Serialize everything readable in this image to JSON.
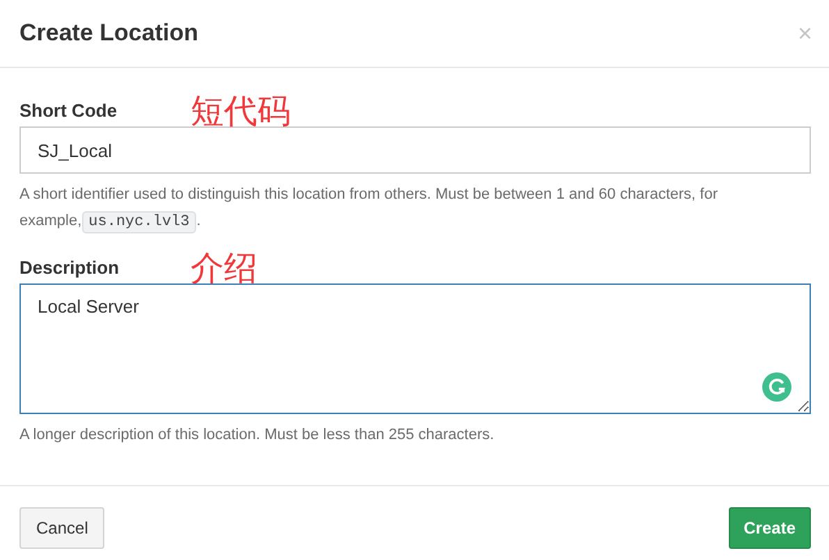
{
  "dialog": {
    "title": "Create Location",
    "close": "×"
  },
  "fields": [
    {
      "kind": "input",
      "label": "Short Code",
      "annotation": "短代码",
      "value": "SJ_Local",
      "focused": false,
      "help": "A short identifier used to distinguish this location from others. Must be between 1 and 60 characters, for example,",
      "example": "us.nyc.lvl3",
      "help_end": "."
    },
    {
      "kind": "textarea",
      "label": "Description",
      "annotation": "介绍",
      "value": "Local Server",
      "focused": true,
      "help": "A longer description of this location. Must be less than 255 characters."
    }
  ],
  "buttons": [
    {
      "label": "Cancel",
      "kind": "default"
    },
    {
      "label": "Create",
      "kind": "primary"
    }
  ]
}
